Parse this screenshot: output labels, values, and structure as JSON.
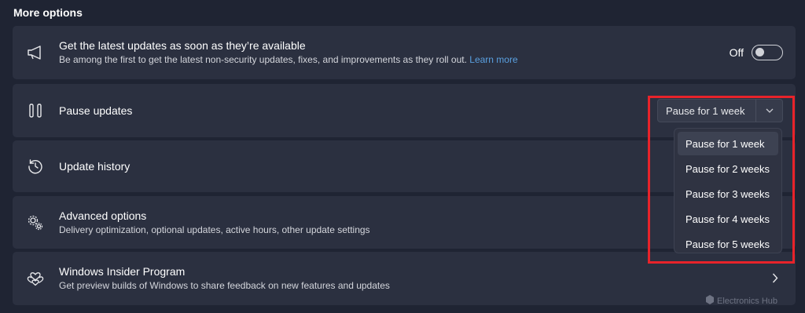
{
  "section_title": "More options",
  "latest_updates": {
    "title": "Get the latest updates as soon as they’re available",
    "desc": "Be among the first to get the latest non-security updates, fixes, and improvements as they roll out.",
    "link": "Learn more",
    "toggle_label": "Off",
    "toggle_on": false,
    "icon": "megaphone-icon"
  },
  "pause_updates": {
    "title": "Pause updates",
    "selected": "Pause for 1 week",
    "icon": "pause-icon",
    "options": [
      "Pause for 1 week",
      "Pause for 2 weeks",
      "Pause for 3 weeks",
      "Pause for 4 weeks",
      "Pause for 5 weeks"
    ]
  },
  "update_history": {
    "title": "Update history",
    "icon": "history-icon"
  },
  "advanced_options": {
    "title": "Advanced options",
    "desc": "Delivery optimization, optional updates, active hours, other update settings",
    "icon": "gears-icon"
  },
  "insider_program": {
    "title": "Windows Insider Program",
    "desc": "Get preview builds of Windows to share feedback on new features and updates",
    "icon": "insider-hearts-icon"
  },
  "watermark": "Electronics Hub",
  "colors": {
    "background": "#1f2433",
    "card": "#2b3040",
    "highlight": "#e8232a",
    "link": "#5aa0e0"
  }
}
